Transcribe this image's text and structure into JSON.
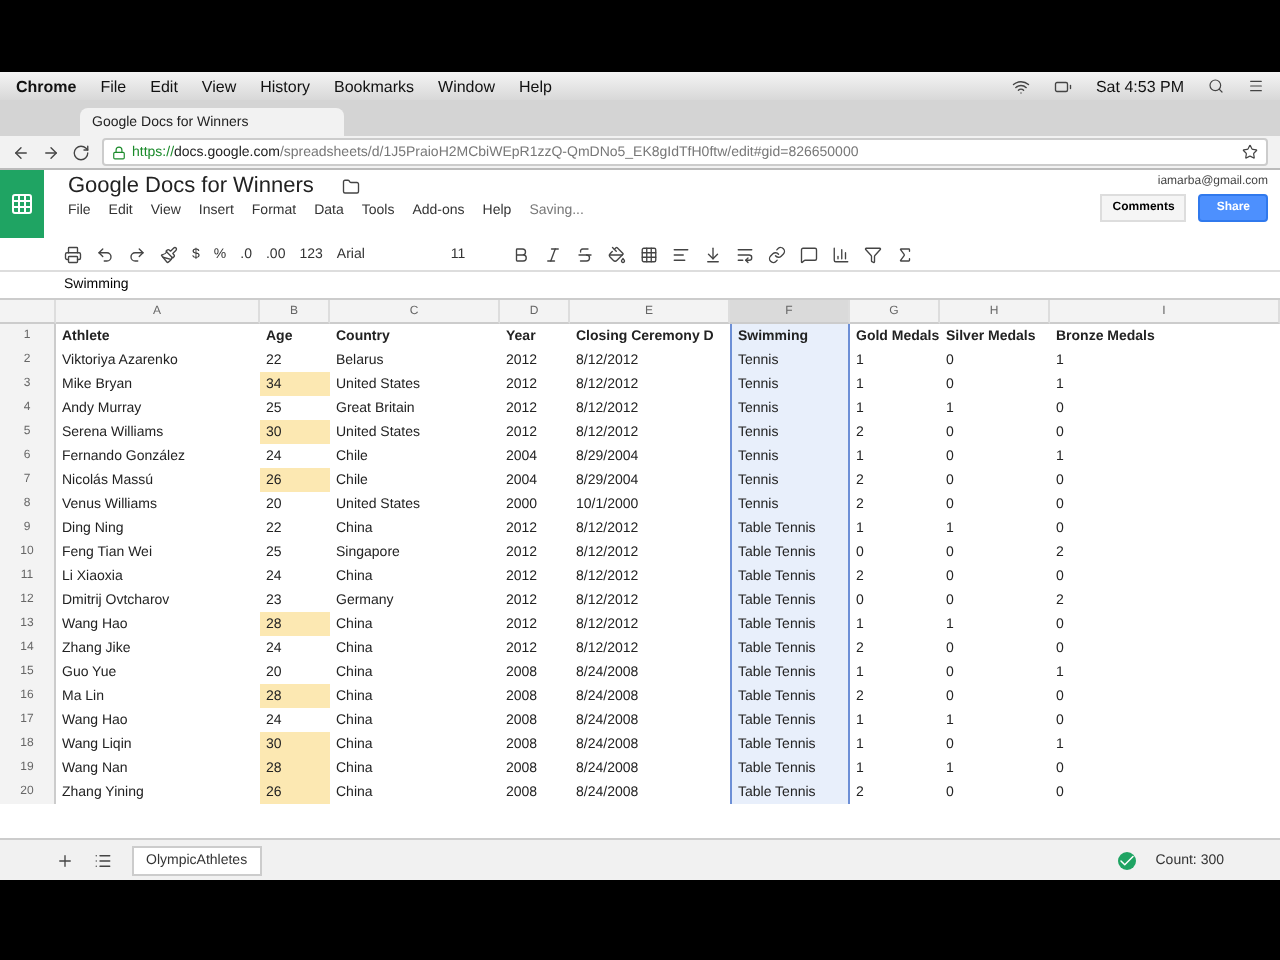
{
  "menubar": {
    "app": "Chrome",
    "items": [
      "File",
      "Edit",
      "View",
      "History",
      "Bookmarks",
      "Window",
      "Help"
    ],
    "clock": "Sat 4:53 PM"
  },
  "browser": {
    "tab": "Google Docs for Winners",
    "url_scheme": "https://",
    "url_host": "docs.google.com",
    "url_path": "/spreadsheets/d/1J5PraioH2MCbiWEpR1zzQ-QmDNo5_EK8gIdTfH0ftw/edit#gid=826650000"
  },
  "doc": {
    "title": "Google Docs for Winners",
    "menus": [
      "File",
      "Edit",
      "View",
      "Insert",
      "Format",
      "Data",
      "Tools",
      "Add-ons",
      "Help"
    ],
    "status": "Saving...",
    "account": "iamarba@gmail.com",
    "comments": "Comments",
    "share": "Share"
  },
  "toolbar": {
    "currency": "$",
    "percent": "%",
    "decrease_decimals": ".0",
    "increase_decimals": ".00",
    "more_formats": "123",
    "font": "Arial",
    "size": "11"
  },
  "formula": "Swimming",
  "columns": [
    {
      "label": "A",
      "selected": false
    },
    {
      "label": "B",
      "selected": false
    },
    {
      "label": "C",
      "selected": false
    },
    {
      "label": "D",
      "selected": false
    },
    {
      "label": "E",
      "selected": false
    },
    {
      "label": "F",
      "selected": true
    },
    {
      "label": "G",
      "selected": false
    },
    {
      "label": "H",
      "selected": false
    },
    {
      "label": "I",
      "selected": false
    }
  ],
  "header": {
    "number": "1",
    "cells": [
      "Athlete",
      "Age",
      "Country",
      "Year",
      "Closing Ceremony D",
      "Swimming",
      "Gold Medals",
      "Silver Medals",
      "Bronze Medals"
    ]
  },
  "rows": [
    {
      "number": "2",
      "highlighted": false,
      "cells": [
        "Viktoriya Azarenko",
        "22",
        "Belarus",
        "2012",
        "8/12/2012",
        "Tennis",
        "1",
        "0",
        "1"
      ]
    },
    {
      "number": "3",
      "highlighted": true,
      "cells": [
        "Mike Bryan",
        "34",
        "United States",
        "2012",
        "8/12/2012",
        "Tennis",
        "1",
        "0",
        "1"
      ]
    },
    {
      "number": "4",
      "highlighted": false,
      "cells": [
        "Andy Murray",
        "25",
        "Great Britain",
        "2012",
        "8/12/2012",
        "Tennis",
        "1",
        "1",
        "0"
      ]
    },
    {
      "number": "5",
      "highlighted": true,
      "cells": [
        "Serena Williams",
        "30",
        "United States",
        "2012",
        "8/12/2012",
        "Tennis",
        "2",
        "0",
        "0"
      ]
    },
    {
      "number": "6",
      "highlighted": false,
      "cells": [
        "Fernando González",
        "24",
        "Chile",
        "2004",
        "8/29/2004",
        "Tennis",
        "1",
        "0",
        "1"
      ]
    },
    {
      "number": "7",
      "highlighted": true,
      "cells": [
        "Nicolás Massú",
        "26",
        "Chile",
        "2004",
        "8/29/2004",
        "Tennis",
        "2",
        "0",
        "0"
      ]
    },
    {
      "number": "8",
      "highlighted": false,
      "cells": [
        "Venus Williams",
        "20",
        "United States",
        "2000",
        "10/1/2000",
        "Tennis",
        "2",
        "0",
        "0"
      ]
    },
    {
      "number": "9",
      "highlighted": false,
      "cells": [
        "Ding Ning",
        "22",
        "China",
        "2012",
        "8/12/2012",
        "Table Tennis",
        "1",
        "1",
        "0"
      ]
    },
    {
      "number": "10",
      "highlighted": false,
      "cells": [
        "Feng Tian Wei",
        "25",
        "Singapore",
        "2012",
        "8/12/2012",
        "Table Tennis",
        "0",
        "0",
        "2"
      ]
    },
    {
      "number": "11",
      "highlighted": false,
      "cells": [
        "Li Xiaoxia",
        "24",
        "China",
        "2012",
        "8/12/2012",
        "Table Tennis",
        "2",
        "0",
        "0"
      ]
    },
    {
      "number": "12",
      "highlighted": false,
      "cells": [
        "Dmitrij Ovtcharov",
        "23",
        "Germany",
        "2012",
        "8/12/2012",
        "Table Tennis",
        "0",
        "0",
        "2"
      ]
    },
    {
      "number": "13",
      "highlighted": true,
      "cells": [
        "Wang Hao",
        "28",
        "China",
        "2012",
        "8/12/2012",
        "Table Tennis",
        "1",
        "1",
        "0"
      ]
    },
    {
      "number": "14",
      "highlighted": false,
      "cells": [
        "Zhang Jike",
        "24",
        "China",
        "2012",
        "8/12/2012",
        "Table Tennis",
        "2",
        "0",
        "0"
      ]
    },
    {
      "number": "15",
      "highlighted": false,
      "cells": [
        "Guo Yue",
        "20",
        "China",
        "2008",
        "8/24/2008",
        "Table Tennis",
        "1",
        "0",
        "1"
      ]
    },
    {
      "number": "16",
      "highlighted": true,
      "cells": [
        "Ma Lin",
        "28",
        "China",
        "2008",
        "8/24/2008",
        "Table Tennis",
        "2",
        "0",
        "0"
      ]
    },
    {
      "number": "17",
      "highlighted": false,
      "cells": [
        "Wang Hao",
        "24",
        "China",
        "2008",
        "8/24/2008",
        "Table Tennis",
        "1",
        "1",
        "0"
      ]
    },
    {
      "number": "18",
      "highlighted": true,
      "cells": [
        "Wang Liqin",
        "30",
        "China",
        "2008",
        "8/24/2008",
        "Table Tennis",
        "1",
        "0",
        "1"
      ]
    },
    {
      "number": "19",
      "highlighted": true,
      "cells": [
        "Wang Nan",
        "28",
        "China",
        "2008",
        "8/24/2008",
        "Table Tennis",
        "1",
        "1",
        "0"
      ]
    },
    {
      "number": "20",
      "highlighted": true,
      "cells": [
        "Zhang Yining",
        "26",
        "China",
        "2008",
        "8/24/2008",
        "Table Tennis",
        "2",
        "0",
        "0"
      ]
    }
  ],
  "sheet_tab": "OlympicAthletes",
  "summary": "Count: 300"
}
